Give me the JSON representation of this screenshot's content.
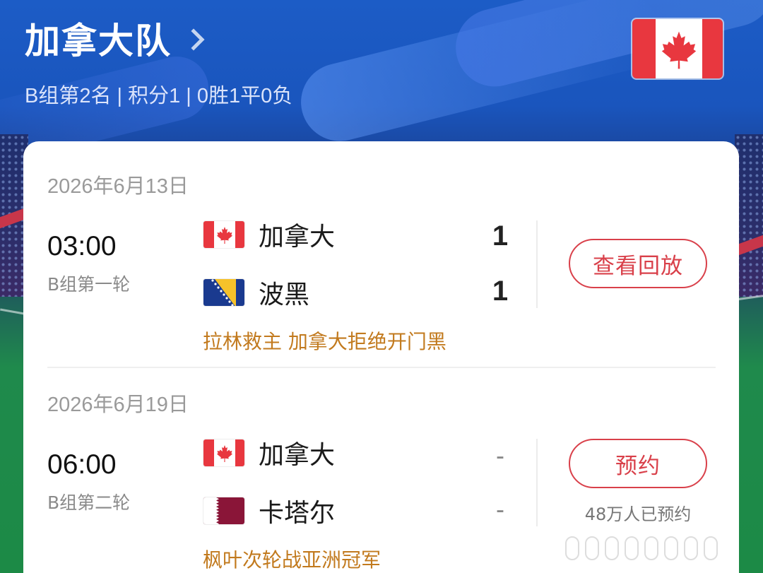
{
  "team": {
    "name": "加拿大队",
    "summary": "B组第2名 | 积分1 | 0胜1平0负",
    "flag_icon": "canada-flag-icon"
  },
  "colors": {
    "accent": "#d9404a",
    "headline": "#c27a1e",
    "header_blue": "#1c5cc6"
  },
  "matches": [
    {
      "date": "2026年6月13日",
      "time": "03:00",
      "round": "B组第一轮",
      "home": {
        "name": "加拿大",
        "flag_icon": "canada-flag-icon",
        "score": "1"
      },
      "away": {
        "name": "波黑",
        "flag_icon": "bosnia-flag-icon",
        "score": "1"
      },
      "action_label": "查看回放",
      "headline": "拉林救主 加拿大拒绝开门黑"
    },
    {
      "date": "2026年6月19日",
      "time": "06:00",
      "round": "B组第二轮",
      "home": {
        "name": "加拿大",
        "flag_icon": "canada-flag-icon",
        "score": "-"
      },
      "away": {
        "name": "卡塔尔",
        "flag_icon": "qatar-flag-icon",
        "score": "-"
      },
      "action_label": "预约",
      "reserve_count": "48万人已预约",
      "headline": "枫叶次轮战亚洲冠军"
    }
  ]
}
